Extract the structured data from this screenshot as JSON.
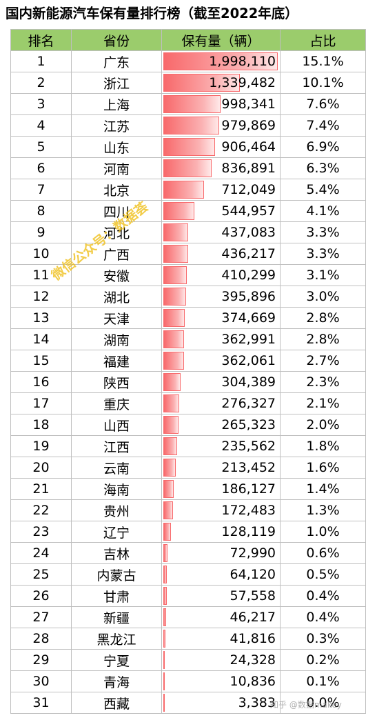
{
  "title": "国内新能源汽车保有量排行榜（截至2022年底）",
  "table": {
    "headers": [
      "排名",
      "省份",
      "保有量（辆）",
      "占比"
    ],
    "rows": [
      {
        "rank": "1",
        "province": "广东",
        "count": "1,998,110",
        "share": "15.1%",
        "value": 1998110
      },
      {
        "rank": "2",
        "province": "浙江",
        "count": "1,339,482",
        "share": "10.1%",
        "value": 1339482
      },
      {
        "rank": "3",
        "province": "上海",
        "count": "998,341",
        "share": "7.6%",
        "value": 998341
      },
      {
        "rank": "4",
        "province": "江苏",
        "count": "979,869",
        "share": "7.4%",
        "value": 979869
      },
      {
        "rank": "5",
        "province": "山东",
        "count": "906,464",
        "share": "6.9%",
        "value": 906464
      },
      {
        "rank": "6",
        "province": "河南",
        "count": "836,891",
        "share": "6.3%",
        "value": 836891
      },
      {
        "rank": "7",
        "province": "北京",
        "count": "712,049",
        "share": "5.4%",
        "value": 712049
      },
      {
        "rank": "8",
        "province": "四川",
        "count": "544,957",
        "share": "4.1%",
        "value": 544957
      },
      {
        "rank": "9",
        "province": "河北",
        "count": "437,083",
        "share": "3.3%",
        "value": 437083
      },
      {
        "rank": "10",
        "province": "广西",
        "count": "436,217",
        "share": "3.3%",
        "value": 436217
      },
      {
        "rank": "11",
        "province": "安徽",
        "count": "410,299",
        "share": "3.1%",
        "value": 410299
      },
      {
        "rank": "12",
        "province": "湖北",
        "count": "395,896",
        "share": "3.0%",
        "value": 395896
      },
      {
        "rank": "13",
        "province": "天津",
        "count": "374,669",
        "share": "2.8%",
        "value": 374669
      },
      {
        "rank": "14",
        "province": "湖南",
        "count": "362,991",
        "share": "2.8%",
        "value": 362991
      },
      {
        "rank": "15",
        "province": "福建",
        "count": "362,061",
        "share": "2.7%",
        "value": 362061
      },
      {
        "rank": "16",
        "province": "陕西",
        "count": "304,389",
        "share": "2.3%",
        "value": 304389
      },
      {
        "rank": "17",
        "province": "重庆",
        "count": "276,327",
        "share": "2.1%",
        "value": 276327
      },
      {
        "rank": "18",
        "province": "山西",
        "count": "265,323",
        "share": "2.0%",
        "value": 265323
      },
      {
        "rank": "19",
        "province": "江西",
        "count": "235,562",
        "share": "1.8%",
        "value": 235562
      },
      {
        "rank": "20",
        "province": "云南",
        "count": "213,452",
        "share": "1.6%",
        "value": 213452
      },
      {
        "rank": "21",
        "province": "海南",
        "count": "186,127",
        "share": "1.4%",
        "value": 186127
      },
      {
        "rank": "22",
        "province": "贵州",
        "count": "172,483",
        "share": "1.3%",
        "value": 172483
      },
      {
        "rank": "23",
        "province": "辽宁",
        "count": "128,119",
        "share": "1.0%",
        "value": 128119
      },
      {
        "rank": "24",
        "province": "吉林",
        "count": "72,990",
        "share": "0.6%",
        "value": 72990
      },
      {
        "rank": "25",
        "province": "内蒙古",
        "count": "64,120",
        "share": "0.5%",
        "value": 64120
      },
      {
        "rank": "26",
        "province": "甘肃",
        "count": "57,558",
        "share": "0.4%",
        "value": 57558
      },
      {
        "rank": "27",
        "province": "新疆",
        "count": "46,217",
        "share": "0.4%",
        "value": 46217
      },
      {
        "rank": "28",
        "province": "黑龙江",
        "count": "41,816",
        "share": "0.3%",
        "value": 41816
      },
      {
        "rank": "29",
        "province": "宁夏",
        "count": "24,328",
        "share": "0.2%",
        "value": 24328
      },
      {
        "rank": "30",
        "province": "青海",
        "count": "10,836",
        "share": "0.1%",
        "value": 10836
      },
      {
        "rank": "31",
        "province": "西藏",
        "count": "3,383",
        "share": "0.0%",
        "value": 3383
      }
    ]
  },
  "watermarks": {
    "diagonal": "微信公众号：数据荟",
    "corner": "知乎 @数据makey"
  },
  "colors": {
    "header_bg": "#9bcc6c",
    "bar": "#f8696b",
    "grid": "#bfbfbf",
    "watermark": "#eebe14"
  }
}
